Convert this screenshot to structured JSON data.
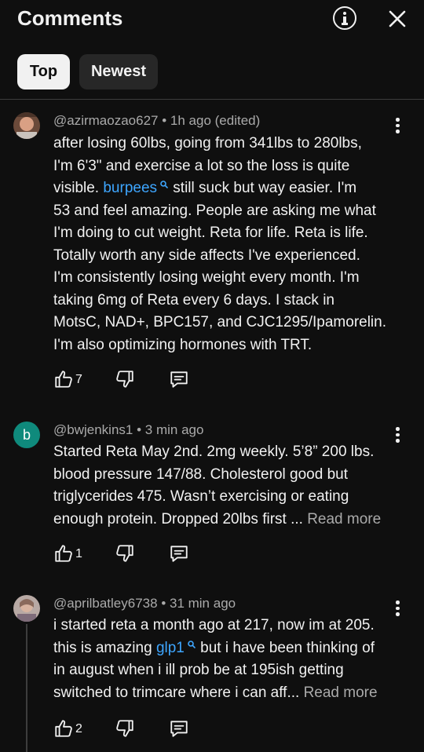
{
  "header": {
    "title": "Comments"
  },
  "filters": {
    "top": "Top",
    "newest": "Newest"
  },
  "comments": [
    {
      "author": "@azirmaozao627",
      "time": "• 1h ago (edited)",
      "lines": [
        [
          "after losing 60lbs, going from 341lbs to 280lbs,"
        ],
        [
          "I'm 6'3\" and exercise a lot so the loss is quite"
        ],
        [
          "visible. ",
          "burpees",
          " still suck but way easier.  I'm"
        ],
        [
          "53 and feel amazing.  People are asking me what"
        ],
        [
          "I'm doing to cut weight.  Reta for life.  Reta is life."
        ],
        [
          "Totally worth any side affects I've experienced."
        ],
        [
          "I'm consistently losing weight every month.  I'm"
        ],
        [
          "taking 6mg of Reta every 6 days.  I stack in"
        ],
        [
          "MotsC, NAD+, BPC157, and CJC1295/Ipamorelin."
        ],
        [
          "I'm also optimizing hormones with TRT."
        ]
      ],
      "likes": "7"
    },
    {
      "author": "@bwjenkins1",
      "time": "• 3 min ago",
      "avatar_letter": "b",
      "lines": [
        [
          "Started Reta May 2nd. 2mg weekly. 5’8” 200 lbs."
        ],
        [
          "blood pressure 147/88. Cholesterol good but"
        ],
        [
          "triglycerides 475. Wasn’t exercising or eating"
        ],
        [
          "enough protein. Dropped 20lbs first ... "
        ]
      ],
      "read_more": "Read more",
      "likes": "1"
    },
    {
      "author": "@aprilbatley6738",
      "time": "• 31 min ago",
      "lines": [
        [
          "i started reta a month ago at 217, now im at 205."
        ],
        [
          "this is amazing ",
          "glp1",
          " but i have been thinking of"
        ],
        [
          "in august when i ill prob be at 195ish getting"
        ],
        [
          "switched to trimcare where i can aff... "
        ]
      ],
      "read_more": "Read more",
      "likes": "2"
    }
  ],
  "colors": {
    "background": "#0f0f0f",
    "link": "#3ea6ff",
    "avatar_b": "#0f8a7c"
  }
}
